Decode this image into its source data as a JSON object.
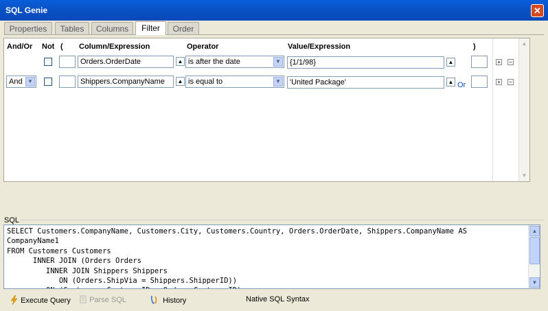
{
  "window": {
    "title": "SQL Genie",
    "close_glyph": "✕"
  },
  "tabs": [
    {
      "label": "Properties",
      "active": false
    },
    {
      "label": "Tables",
      "active": false
    },
    {
      "label": "Columns",
      "active": false
    },
    {
      "label": "Filter",
      "active": true
    },
    {
      "label": "Order",
      "active": false
    }
  ],
  "filter": {
    "headers": {
      "and_or": "And/Or",
      "not": "Not",
      "open_paren": "(",
      "column": "Column/Expression",
      "operator": "Operator",
      "value": "Value/Expression",
      "close_paren": ")"
    },
    "rows": [
      {
        "and_or": "",
        "column": "Orders.OrderDate",
        "operator": "is after the date",
        "value": "{1/1/98}",
        "or_link": ""
      },
      {
        "and_or": "And",
        "column": "Shippers.CompanyName",
        "operator": "is equal to",
        "value": "'United Package'",
        "or_link": "Or"
      }
    ]
  },
  "sql": {
    "label": "SQL",
    "text": "SELECT Customers.CompanyName, Customers.City, Customers.Country, Orders.OrderDate, Shippers.CompanyName AS\nCompanyName1\nFROM Customers Customers\n      INNER JOIN (Orders Orders\n         INNER JOIN Shippers Shippers\n            ON (Orders.ShipVia = Shippers.ShipperID))\n         ON (Customers.CustomerID = Orders.CustomerID)"
  },
  "toolbar": {
    "execute": "Execute Query",
    "parse": "Parse SQL",
    "history": "History",
    "native": "Native SQL Syntax"
  },
  "icons": {
    "execute": "lightning-icon",
    "parse": "parse-icon",
    "history": "history-icon",
    "up": "up-arrow-icon",
    "dropdown": "dropdown-arrow-icon",
    "add": "plus-icon",
    "remove": "minus-icon"
  },
  "colors": {
    "title_bar": "#0a5fd8",
    "close_button": "#d8491f",
    "link": "#0b4fd0",
    "execute_icon": "#e8a300"
  }
}
